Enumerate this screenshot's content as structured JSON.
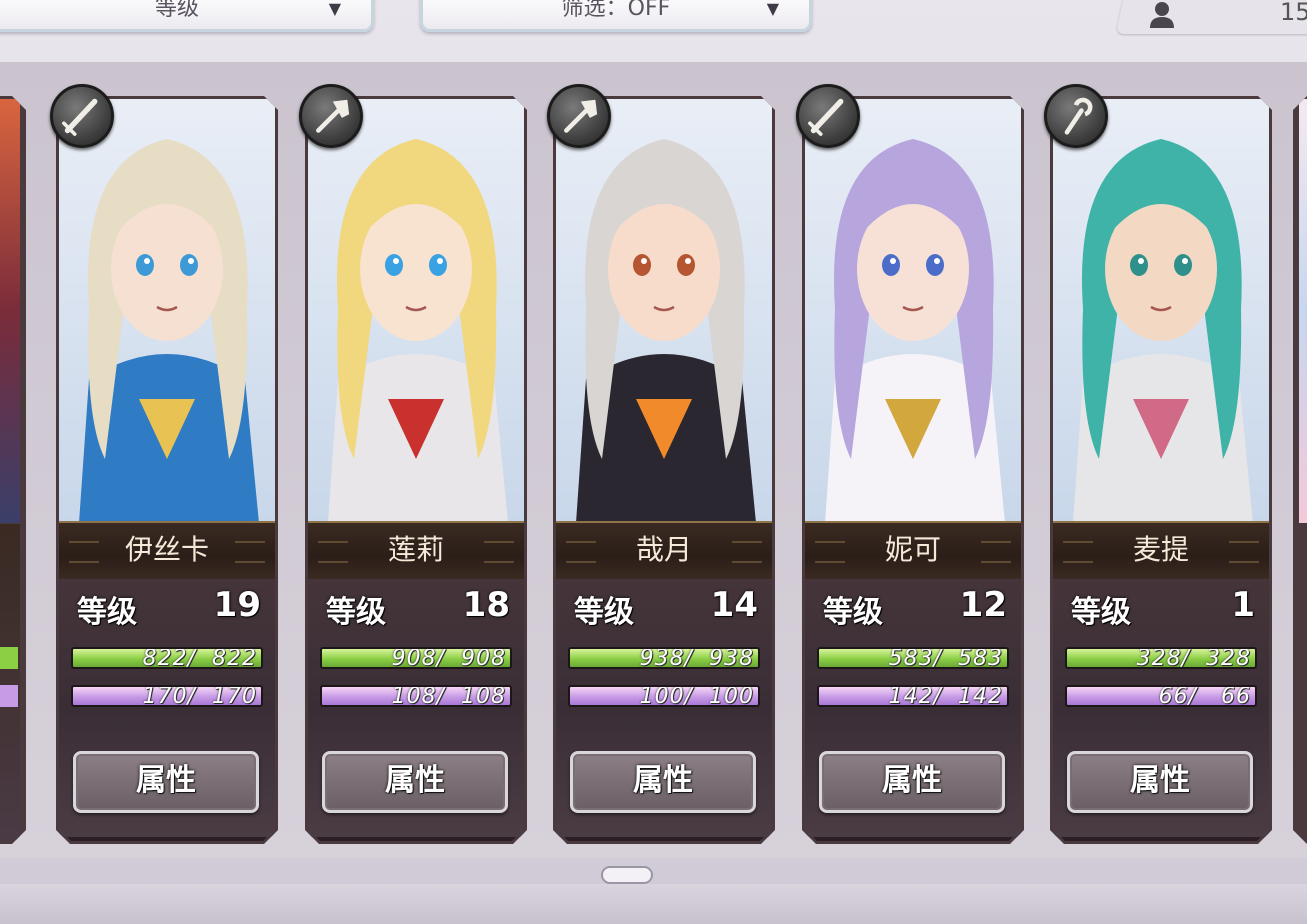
{
  "header": {
    "sort_label": "等级",
    "filter_label": "筛选：OFF",
    "player_value": "15"
  },
  "pager": {
    "current_page": 1
  },
  "characters": [
    {
      "name": "伊丝卡",
      "level_label": "等级",
      "level": "19",
      "hp_current": 822,
      "hp_max": 822,
      "hp_text": "822/  822",
      "sp_current": 170,
      "sp_max": 170,
      "sp_text": "170/  170",
      "button": "属性",
      "weapon": "sword-icon"
    },
    {
      "name": "莲莉",
      "level_label": "等级",
      "level": "18",
      "hp_current": 908,
      "hp_max": 908,
      "hp_text": "908/  908",
      "sp_current": 108,
      "sp_max": 108,
      "sp_text": "108/  108",
      "button": "属性",
      "weapon": "axe-icon"
    },
    {
      "name": "哉月",
      "level_label": "等级",
      "level": "14",
      "hp_current": 938,
      "hp_max": 938,
      "hp_text": "938/  938",
      "sp_current": 100,
      "sp_max": 100,
      "sp_text": "100/  100",
      "button": "属性",
      "weapon": "axe-icon"
    },
    {
      "name": "妮可",
      "level_label": "等级",
      "level": "12",
      "hp_current": 583,
      "hp_max": 583,
      "hp_text": "583/  583",
      "sp_current": 142,
      "sp_max": 142,
      "sp_text": "142/  142",
      "button": "属性",
      "weapon": "sword-icon"
    },
    {
      "name": "麦提",
      "level_label": "等级",
      "level": "1",
      "hp_current": 328,
      "hp_max": 328,
      "hp_text": "328/  328",
      "sp_current": 66,
      "sp_max": 66,
      "sp_text": "66/   66",
      "button": "属性",
      "weapon": "staff-icon"
    }
  ],
  "colors": {
    "hp_bar": "#8bcf45",
    "sp_bar": "#c79be6",
    "card_frame": "#4a3a3e",
    "name_text": "#f3ead9"
  }
}
